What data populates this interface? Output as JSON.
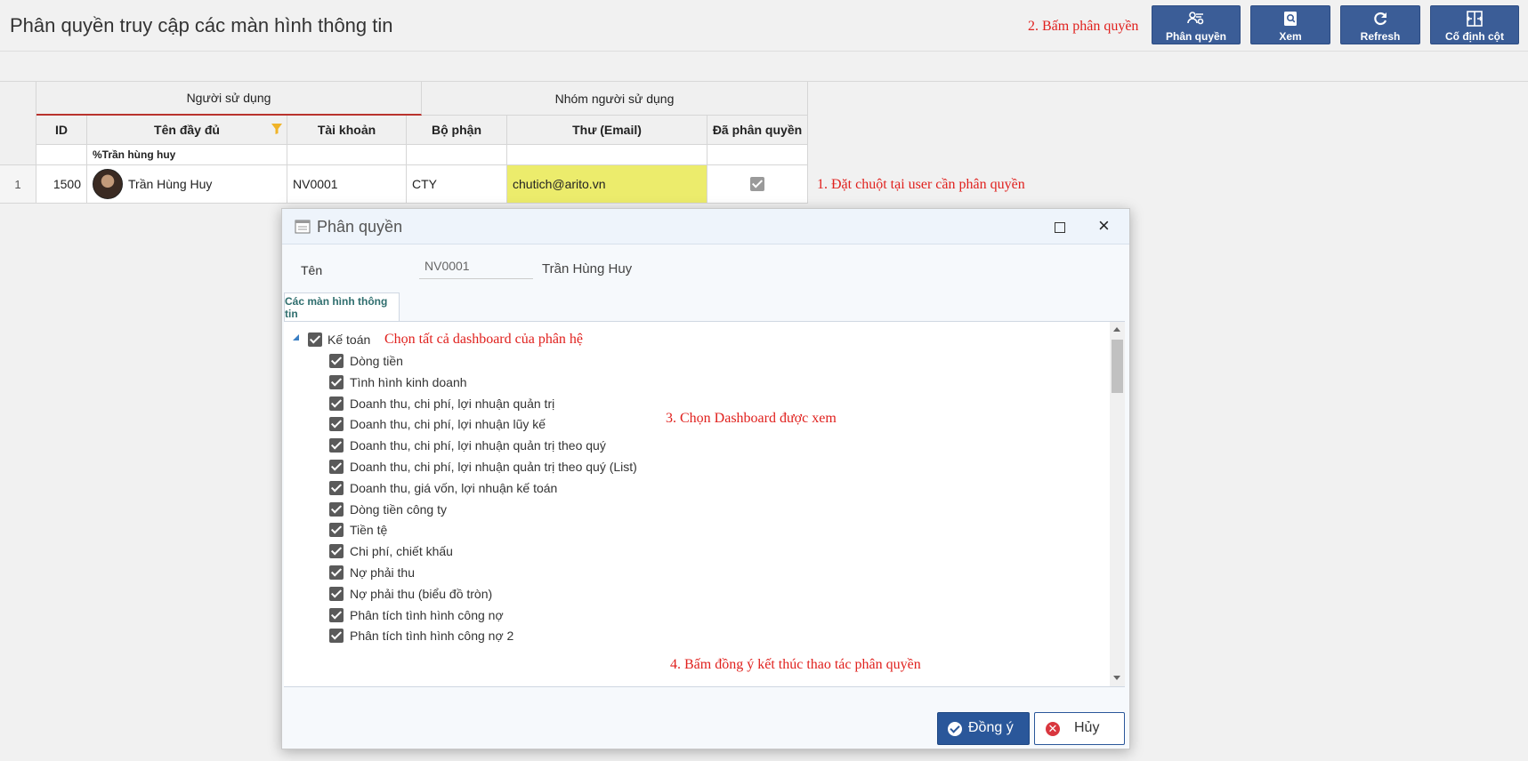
{
  "page": {
    "title": "Phân quyền truy cập các màn hình thông tin"
  },
  "annotations": {
    "step1": "1. Đặt chuột tại user cần phân quyền",
    "step2": "2. Bấm phân quyền",
    "step3": "3. Chọn Dashboard được xem",
    "step4": "4. Bấm đồng ý kết thúc thao tác phân quyền",
    "select_all": "Chọn tất cả dashboard của phân hệ"
  },
  "toolbar": {
    "buttons": [
      {
        "label": "Phân quyền",
        "icon": "users-gear-icon"
      },
      {
        "label": "Xem",
        "icon": "view-icon"
      },
      {
        "label": "Refresh",
        "icon": "refresh-icon"
      },
      {
        "label": "Cố định cột",
        "icon": "pin-columns-icon"
      }
    ]
  },
  "grid": {
    "tabs": [
      "Người sử dụng",
      "Nhóm người sử dụng"
    ],
    "columns": [
      "ID",
      "Tên đầy đủ",
      "Tài khoản",
      "Bộ phận",
      "Thư (Email)",
      "Đã phân quyền"
    ],
    "filter_value": "%Trần hùng huy",
    "rows": [
      {
        "row_num": "1",
        "id": "1500",
        "full_name": "Trần Hùng Huy",
        "account": "NV0001",
        "department": "CTY",
        "email": "chutich@arito.vn",
        "authorized": true
      }
    ],
    "highlight_color": "#ecec6c"
  },
  "dialog": {
    "title": "Phân quyền",
    "name_label": "Tên",
    "account_value": "NV0001",
    "user_name": "Trần Hùng Huy",
    "tab": "Các màn hình thông tin",
    "tree_group": "Kế toán",
    "items": [
      "Dòng tiền",
      "Tình hình kinh doanh",
      "Doanh thu, chi phí, lợi nhuận quản trị",
      "Doanh thu, chi phí, lợi nhuận lũy kế",
      "Doanh thu, chi phí, lợi nhuận quản trị theo quý",
      "Doanh thu, chi phí, lợi nhuận quản trị theo quý (List)",
      "Doanh thu, giá vốn, lợi nhuận kế toán",
      "Dòng tiền công ty",
      "Tiền tệ",
      "Chi phí, chiết khấu",
      "Nợ phải thu",
      "Nợ phải thu (biểu đồ tròn)",
      "Phân tích tình hình công nợ",
      "Phân tích tình hình công nợ 2"
    ],
    "ok_label": "Đồng ý",
    "cancel_label": "Hủy"
  }
}
